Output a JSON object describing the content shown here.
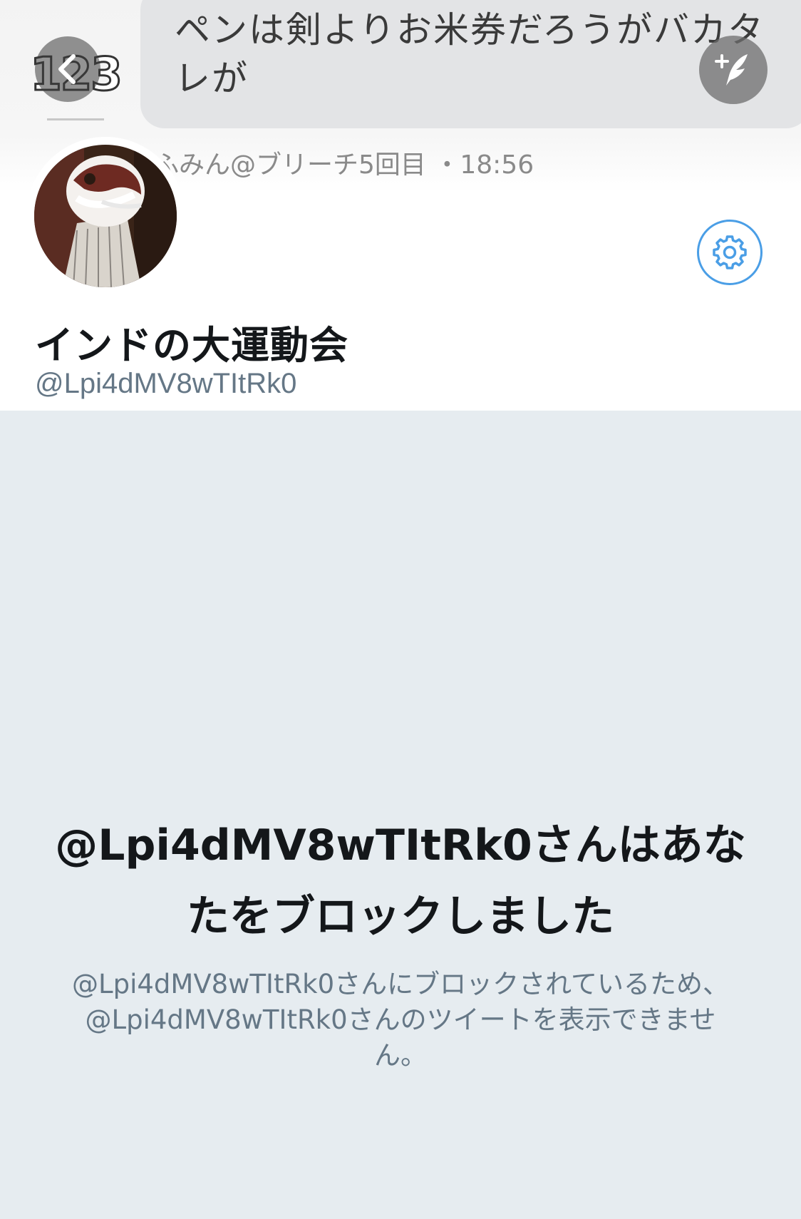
{
  "banner": {
    "tweet_text": "ペンは剣よりお米券だろうがバカタレが",
    "tweet_meta": "ふみん@ブリーチ5回目 ・18:56",
    "logo_text": "123"
  },
  "nav": {
    "back_icon": "chevron-left-icon",
    "compose_icon": "compose-tweet-icon"
  },
  "profile": {
    "display_name": "インドの大運動会",
    "handle": "@Lpi4dMV8wTItRk0",
    "settings_icon": "gear-icon",
    "accent_color": "#4a9ee6"
  },
  "blocked": {
    "title": "@Lpi4dMV8wTItRk0さんはあなたをブロックしました",
    "description": "@Lpi4dMV8wTItRk0さんにブロックされているため、@Lpi4dMV8wTItRk0さんのツイートを表示できません。"
  }
}
